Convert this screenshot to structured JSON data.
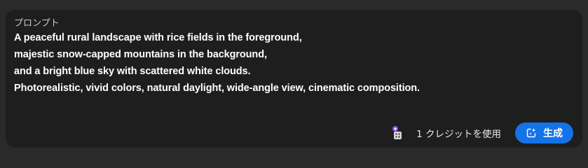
{
  "prompt": {
    "label": "プロンプト",
    "lines": [
      "A peaceful rural landscape with rice fields in the foreground,",
      "majestic snow-capped mountains in the background,",
      "and a bright blue sky with scattered white clouds.",
      "Photorealistic, vivid colors, natural daylight, wide-angle view, cinematic composition."
    ]
  },
  "footer": {
    "credit_icon": "credit-dice-icon",
    "credit_text": "1 クレジットを使用",
    "generate_icon": "sparkle-generate-icon",
    "generate_label": "生成"
  },
  "colors": {
    "background": "#2a2a2a",
    "panel": "#1e1e1e",
    "accent": "#1473e6",
    "credit_badge": "#8a4dff"
  }
}
